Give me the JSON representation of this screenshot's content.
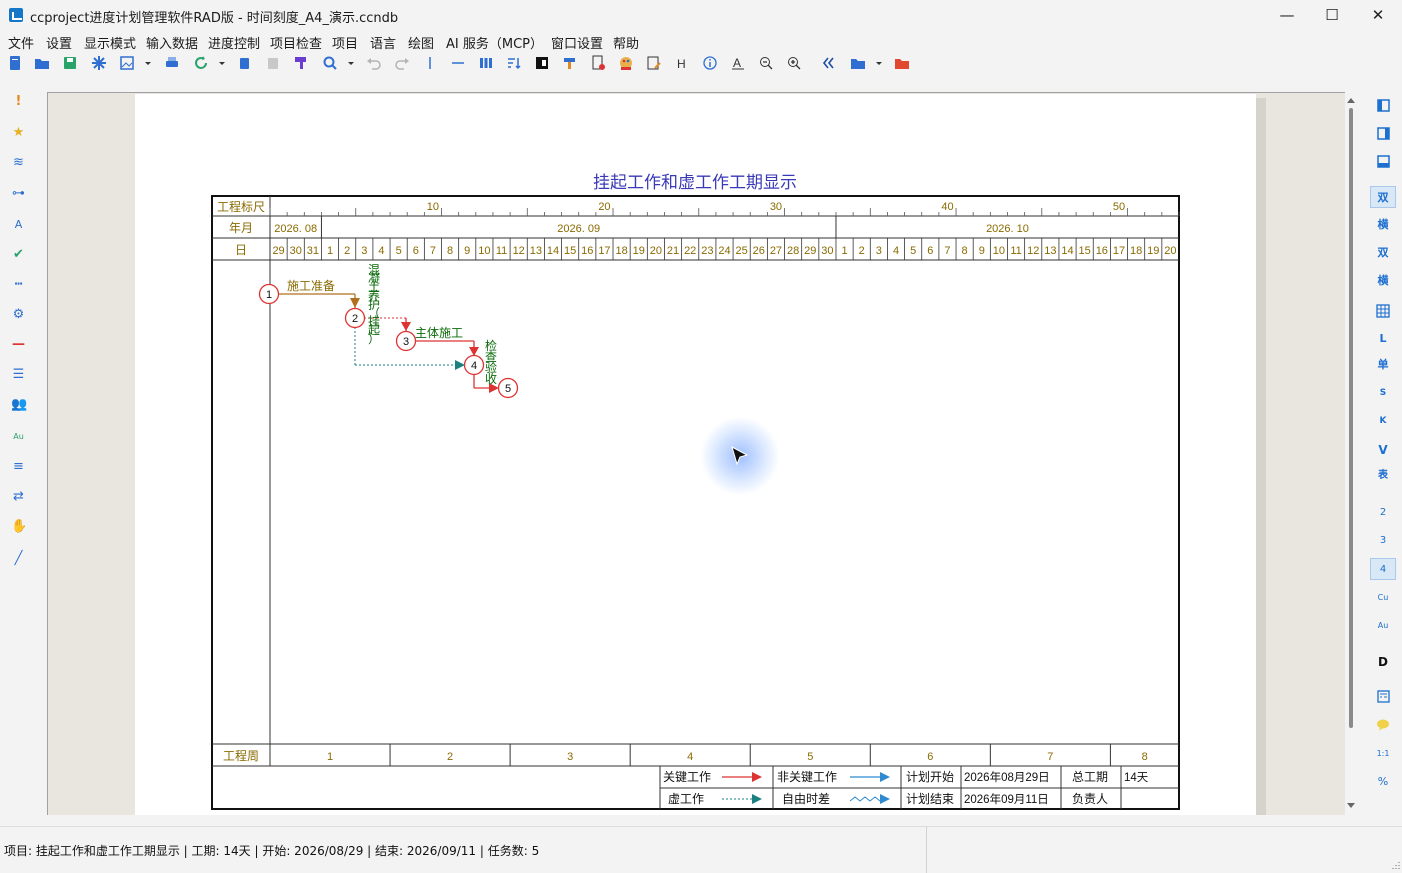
{
  "window": {
    "title": "ccproject进度计划管理软件RAD版 - 时间刻度_A4_演示.ccndb",
    "minimize": "—",
    "maximize": "☐",
    "close": "✕"
  },
  "menu": [
    "文件",
    "设置",
    "显示模式",
    "输入数据",
    "进度控制",
    "项目检查",
    "项目",
    "语言",
    "绘图",
    "AI 服务（MCP）",
    "窗口设置",
    "帮助"
  ],
  "right_tools": [
    "双",
    "横",
    "双",
    "横",
    "L",
    "单",
    "S",
    "K",
    "V",
    "表",
    "2",
    "3",
    "4",
    "Cu",
    "Au",
    "D",
    "1:1",
    "%"
  ],
  "chart": {
    "title": "挂起工作和虚工作工期显示",
    "scale_label": "工程标尺",
    "month_label": "年月",
    "day_label": "日",
    "week_label": "工程周",
    "scale_ticks": [
      "10",
      "20",
      "30",
      "40",
      "50"
    ],
    "months": [
      "2026. 08",
      "2026. 09",
      "2026. 10"
    ],
    "days": [
      "29",
      "30",
      "31",
      "1",
      "2",
      "3",
      "4",
      "5",
      "6",
      "7",
      "8",
      "9",
      "10",
      "11",
      "12",
      "13",
      "14",
      "15",
      "16",
      "17",
      "18",
      "19",
      "20",
      "21",
      "22",
      "23",
      "24",
      "25",
      "26",
      "27",
      "28",
      "29",
      "30",
      "1",
      "2",
      "3",
      "4",
      "5",
      "6",
      "7",
      "8",
      "9",
      "10",
      "11",
      "12",
      "13",
      "14",
      "15",
      "16",
      "17",
      "18",
      "19",
      "20"
    ],
    "weeks": [
      "1",
      "2",
      "3",
      "4",
      "5",
      "6",
      "7",
      "8"
    ],
    "nodes": [
      "1",
      "2",
      "3",
      "4",
      "5"
    ],
    "tasks": {
      "prep": "施工准备",
      "concrete": [
        "混",
        "凝",
        "土",
        "养",
        "护",
        "（",
        "挂",
        "起",
        "）"
      ],
      "main": "主体施工",
      "inspect": [
        "检",
        "查",
        "验",
        "收"
      ]
    },
    "legend": {
      "critical": "关键工作",
      "noncritical": "非关键工作",
      "dummy": "虚工作",
      "float": "自由时差",
      "plan_start_label": "计划开始",
      "plan_start": "2026年08月29日",
      "plan_end_label": "计划结束",
      "plan_end": "2026年09月11日",
      "duration_label": "总工期",
      "duration": "14天",
      "owner_label": "负责人",
      "owner": ""
    }
  },
  "status": {
    "text": "项目: 挂起工作和虚工作工期显示 | 工期: 14天 | 开始: 2026/08/29 | 结束: 2026/09/11 | 任务数: 5"
  }
}
